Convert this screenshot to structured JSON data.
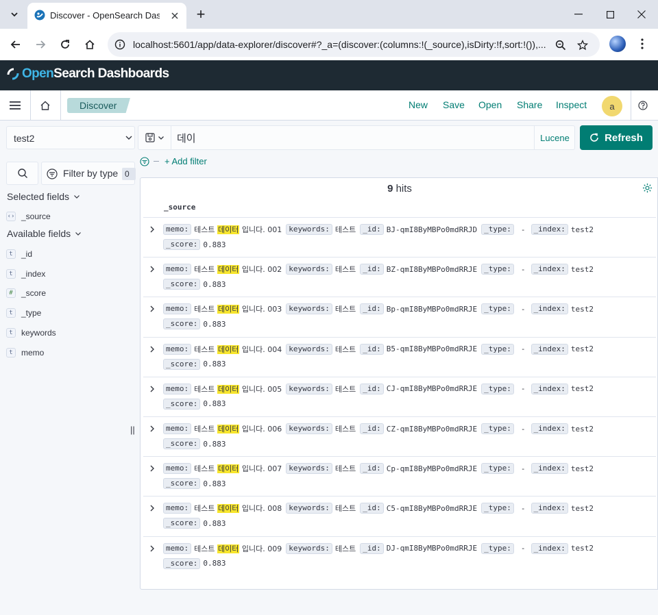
{
  "browser": {
    "tab_title": "Discover - OpenSearch Dashboards",
    "url": "localhost:5601/app/data-explorer/discover#?_a=(discover:(columns:!(_source),isDirty:!f,sort:!()),...",
    "new_tab_glyph": "+"
  },
  "app": {
    "logo_open": "Open",
    "logo_rest": "Search Dashboards",
    "breadcrumb": "Discover",
    "actions": {
      "new": "New",
      "save": "Save",
      "open": "Open",
      "share": "Share",
      "inspect": "Inspect"
    },
    "avatar_initial": "a"
  },
  "sidebar": {
    "index_pattern": "test2",
    "filter_by_type_label": "Filter by type",
    "filter_by_type_count": "0",
    "selected_fields_title": "Selected fields",
    "selected_fields": [
      {
        "type": "source",
        "token": "‹›",
        "name": "_source"
      }
    ],
    "available_fields_title": "Available fields",
    "available_fields": [
      {
        "type": "string",
        "token": "t",
        "name": "_id"
      },
      {
        "type": "string",
        "token": "t",
        "name": "_index"
      },
      {
        "type": "number",
        "token": "#",
        "name": "_score"
      },
      {
        "type": "string",
        "token": "t",
        "name": "_type"
      },
      {
        "type": "string",
        "token": "t",
        "name": "keywords"
      },
      {
        "type": "string",
        "token": "t",
        "name": "memo"
      }
    ],
    "resizer_glyph": "||"
  },
  "query": {
    "value": "데이",
    "language": "Lucene",
    "refresh_label": "Refresh",
    "add_filter_label": "+ Add filter"
  },
  "results": {
    "hits_count": "9",
    "hits_label": "hits",
    "column": "_source",
    "rows": [
      {
        "memo_pre": "테스트 ",
        "memo_hl": "데이터",
        "memo_post": " 입니다. 001",
        "keywords": "테스트",
        "id": "BJ-qmI8ByMBPo0mdRRJD",
        "type": "-",
        "index": "test2",
        "score": "0.883"
      },
      {
        "memo_pre": "테스트 ",
        "memo_hl": "데이터",
        "memo_post": " 입니다. 002",
        "keywords": "테스트",
        "id": "BZ-qmI8ByMBPo0mdRRJE",
        "type": "-",
        "index": "test2",
        "score": "0.883"
      },
      {
        "memo_pre": "테스트 ",
        "memo_hl": "데이터",
        "memo_post": " 입니다. 003",
        "keywords": "테스트",
        "id": "Bp-qmI8ByMBPo0mdRRJE",
        "type": "-",
        "index": "test2",
        "score": "0.883"
      },
      {
        "memo_pre": "테스트 ",
        "memo_hl": "데이터",
        "memo_post": " 입니다. 004",
        "keywords": "테스트",
        "id": "B5-qmI8ByMBPo0mdRRJE",
        "type": "-",
        "index": "test2",
        "score": "0.883"
      },
      {
        "memo_pre": "테스트 ",
        "memo_hl": "데이터",
        "memo_post": " 입니다. 005",
        "keywords": "테스트",
        "id": "CJ-qmI8ByMBPo0mdRRJE",
        "type": "-",
        "index": "test2",
        "score": "0.883"
      },
      {
        "memo_pre": "테스트 ",
        "memo_hl": "데이터",
        "memo_post": " 입니다. 006",
        "keywords": "테스트",
        "id": "CZ-qmI8ByMBPo0mdRRJE",
        "type": "-",
        "index": "test2",
        "score": "0.883"
      },
      {
        "memo_pre": "테스트 ",
        "memo_hl": "데이터",
        "memo_post": " 입니다. 007",
        "keywords": "테스트",
        "id": "Cp-qmI8ByMBPo0mdRRJE",
        "type": "-",
        "index": "test2",
        "score": "0.883"
      },
      {
        "memo_pre": "테스트 ",
        "memo_hl": "데이터",
        "memo_post": " 입니다. 008",
        "keywords": "테스트",
        "id": "C5-qmI8ByMBPo0mdRRJE",
        "type": "-",
        "index": "test2",
        "score": "0.883"
      },
      {
        "memo_pre": "테스트 ",
        "memo_hl": "데이터",
        "memo_post": " 입니다. 009",
        "keywords": "테스트",
        "id": "DJ-qmI8ByMBPo0mdRRJE",
        "type": "-",
        "index": "test2",
        "score": "0.883"
      }
    ],
    "field_keys": {
      "memo": "memo:",
      "keywords": "keywords:",
      "id": "_id:",
      "type": "_type:",
      "index": "_index:",
      "score": "_score:"
    }
  },
  "colors": {
    "accent": "#017d73",
    "header_bg": "#1e2a33",
    "highlight": "#f7e52d",
    "logo_blue": "#3fb5e6"
  }
}
